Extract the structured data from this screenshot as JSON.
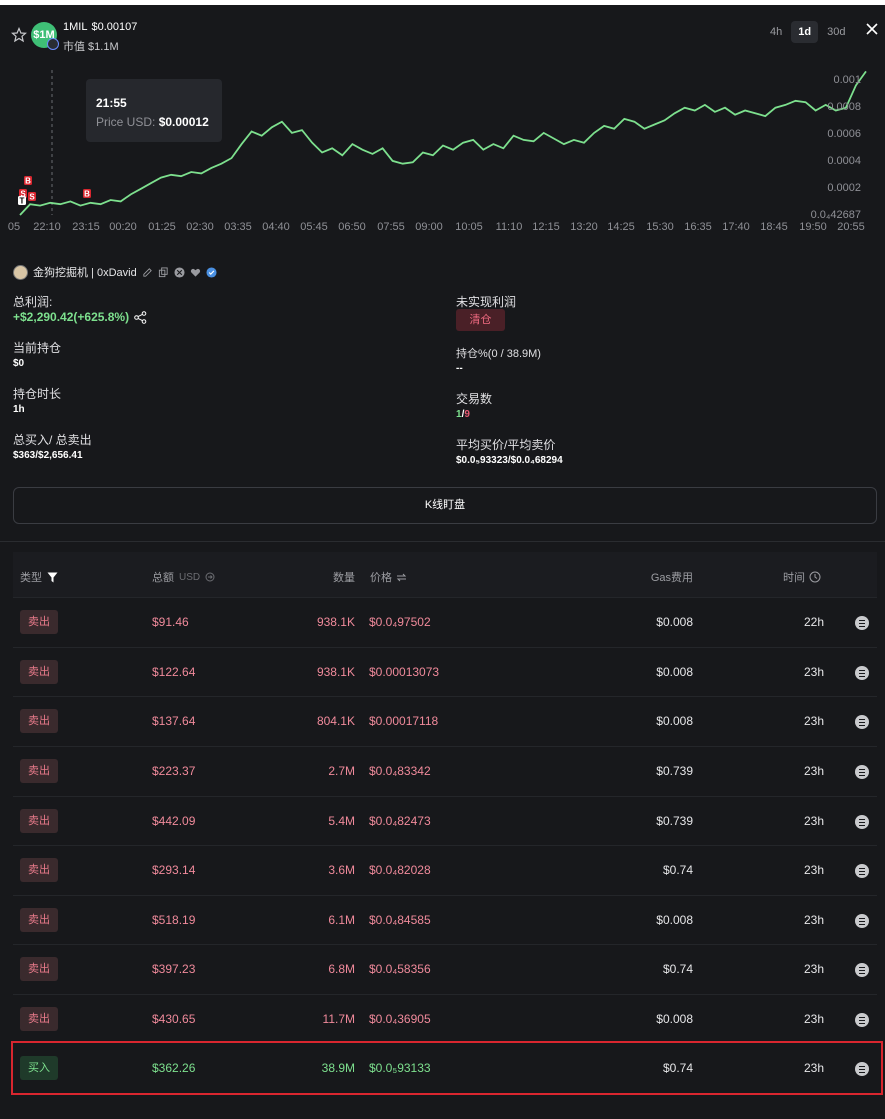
{
  "header": {
    "symbol": "1MIL",
    "price": "$0.00107",
    "logo_text": "$1M",
    "market_cap": "市值 $1.1M",
    "timeframes": [
      "4h",
      "1d",
      "30d"
    ],
    "active_timeframe": "1d"
  },
  "tooltip": {
    "time": "21:55",
    "label": "Price USD:",
    "value": "$0.00012"
  },
  "chart_data": {
    "type": "line",
    "x_tick_labels": [
      "05",
      "22:10",
      "23:15",
      "00:20",
      "01:25",
      "02:30",
      "03:35",
      "04:40",
      "05:45",
      "06:50",
      "07:55",
      "09:00",
      "10:05",
      "11:10",
      "12:15",
      "13:20",
      "14:25",
      "15:30",
      "16:35",
      "17:40",
      "18:45",
      "19:50",
      "20:55"
    ],
    "y_tick_labels": [
      "0.001",
      "0.0008",
      "0.0006",
      "0.0004",
      "0.0002",
      "0.0₄42687"
    ],
    "ylim": [
      4.27e-05,
      0.00108
    ],
    "line_color": "#7de08e",
    "markers": [
      "B",
      "S",
      "S",
      "T",
      "B"
    ],
    "series": [
      {
        "values": [
          4.3e-05,
          0.00012,
          0.00011,
          0.00013,
          0.00012,
          0.00014,
          0.00011,
          0.00013,
          0.00012,
          0.00015,
          0.00014,
          0.00019,
          0.00023,
          0.00027,
          0.00031,
          0.00033,
          0.00032,
          0.00035,
          0.00034,
          0.00038,
          0.00041,
          0.00045,
          0.00055,
          0.00064,
          0.00061,
          0.00067,
          0.00071,
          0.00063,
          0.00065,
          0.00056,
          0.00049,
          0.00052,
          0.00047,
          0.00055,
          0.00051,
          0.00048,
          0.00052,
          0.00043,
          0.00041,
          0.00042,
          0.00049,
          0.00047,
          0.00054,
          0.00051,
          0.00056,
          0.00058,
          0.00051,
          0.00055,
          0.00052,
          0.00061,
          0.00058,
          0.00057,
          0.00063,
          0.00059,
          0.00055,
          0.00058,
          0.00056,
          0.00063,
          0.00068,
          0.00066,
          0.00073,
          0.00071,
          0.00066,
          0.00069,
          0.00072,
          0.00077,
          0.00081,
          0.00079,
          0.00083,
          0.00078,
          0.00081,
          0.00076,
          0.00079,
          0.00077,
          0.00075,
          0.00081,
          0.00083,
          0.00086,
          0.00085,
          0.00079,
          0.00083,
          0.00079,
          0.00081,
          0.00097,
          0.00107
        ]
      }
    ]
  },
  "trader": {
    "name": "金狗挖掘机 | 0xDavid"
  },
  "stats": {
    "total_profit_label": "总利润:",
    "total_profit_value": "+$2,290.42(+625.8%)",
    "unrealized_label": "未实现利润",
    "clear_label": "清仓",
    "holding_label": "当前持仓",
    "holding_value": "$0",
    "holding_pct_label": "持仓%(0 / 38.9M)",
    "holding_pct_value": "--",
    "duration_label": "持仓时长",
    "duration_value": "1h",
    "tx_label": "交易数",
    "tx_buy": "1",
    "tx_sep": "/",
    "tx_sell": "9",
    "buysell_label": "总买入/ 总卖出",
    "buysell_value": "$363/$2,656.41",
    "avg_label": "平均买价/平均卖价",
    "avg_value": "$0.0₅93323/$0.0₄68294"
  },
  "kline_button": "K线盯盘",
  "table": {
    "headers": {
      "type": "类型",
      "amount": "总额",
      "amount_unit": "USD",
      "qty": "数量",
      "price": "价格",
      "gas": "Gas费用",
      "time": "时间"
    },
    "rows": [
      {
        "type": "卖出",
        "amount": "$91.46",
        "qty": "938.1K",
        "price": "$0.0₄97502",
        "gas": "$0.008",
        "time": "22h"
      },
      {
        "type": "卖出",
        "amount": "$122.64",
        "qty": "938.1K",
        "price": "$0.00013073",
        "gas": "$0.008",
        "time": "23h"
      },
      {
        "type": "卖出",
        "amount": "$137.64",
        "qty": "804.1K",
        "price": "$0.00017118",
        "gas": "$0.008",
        "time": "23h"
      },
      {
        "type": "卖出",
        "amount": "$223.37",
        "qty": "2.7M",
        "price": "$0.0₄83342",
        "gas": "$0.739",
        "time": "23h"
      },
      {
        "type": "卖出",
        "amount": "$442.09",
        "qty": "5.4M",
        "price": "$0.0₄82473",
        "gas": "$0.739",
        "time": "23h"
      },
      {
        "type": "卖出",
        "amount": "$293.14",
        "qty": "3.6M",
        "price": "$0.0₄82028",
        "gas": "$0.74",
        "time": "23h"
      },
      {
        "type": "卖出",
        "amount": "$518.19",
        "qty": "6.1M",
        "price": "$0.0₄84585",
        "gas": "$0.008",
        "time": "23h"
      },
      {
        "type": "卖出",
        "amount": "$397.23",
        "qty": "6.8M",
        "price": "$0.0₄58356",
        "gas": "$0.74",
        "time": "23h"
      },
      {
        "type": "卖出",
        "amount": "$430.65",
        "qty": "11.7M",
        "price": "$0.0₄36905",
        "gas": "$0.008",
        "time": "23h"
      },
      {
        "type": "买入",
        "amount": "$362.26",
        "qty": "38.9M",
        "price": "$0.0₅93133",
        "gas": "$0.74",
        "time": "23h"
      }
    ]
  }
}
